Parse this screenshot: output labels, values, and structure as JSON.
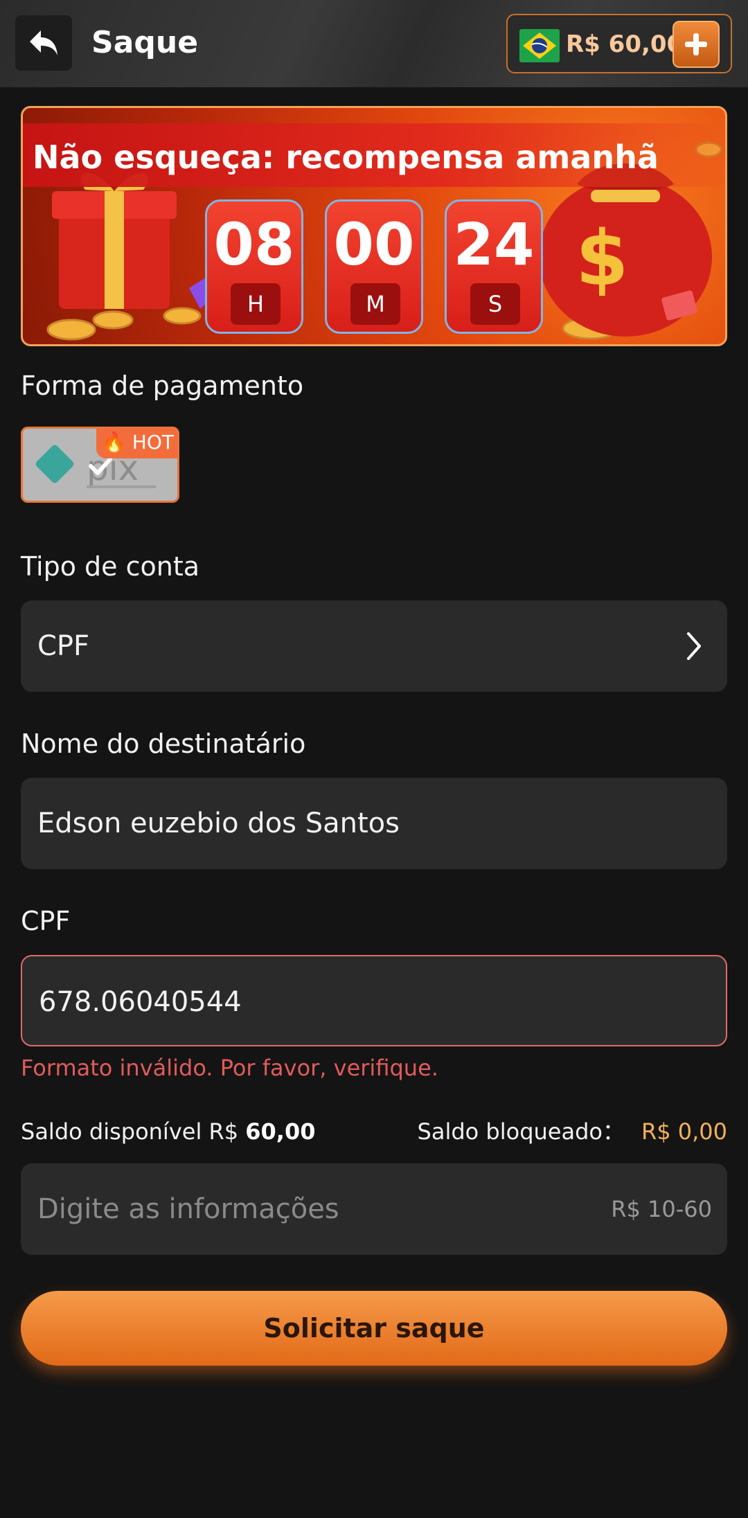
{
  "header": {
    "title": "Saque",
    "balance": "R$ 60,00"
  },
  "banner": {
    "title": "Não esqueça: recompensa amanhã",
    "timer": [
      {
        "value": "08",
        "unit": "H"
      },
      {
        "value": "00",
        "unit": "M"
      },
      {
        "value": "24",
        "unit": "S"
      }
    ]
  },
  "payment": {
    "label": "Forma de pagamento",
    "method": "pix",
    "badge": "HOT"
  },
  "account_type": {
    "label": "Tipo de conta",
    "value": "CPF"
  },
  "recipient": {
    "label": "Nome do destinatário",
    "value": "Edson euzebio dos Santos"
  },
  "cpf": {
    "label": "CPF",
    "value": "678.06040544",
    "error": "Formato inválido. Por favor, verifique."
  },
  "saldo": {
    "available_label": "Saldo disponível R$",
    "available_value": "60,00",
    "blocked_label": "Saldo bloqueado：",
    "blocked_value": "R$ 0,00"
  },
  "amount": {
    "placeholder": "Digite as informações",
    "range": "R$ 10-60"
  },
  "submit_label": "Solicitar saque",
  "colors": {
    "accent": "#e8753a",
    "error": "#e25b5b",
    "gold": "#f5b25a",
    "background": "#141414",
    "field": "#2a2a2a"
  }
}
